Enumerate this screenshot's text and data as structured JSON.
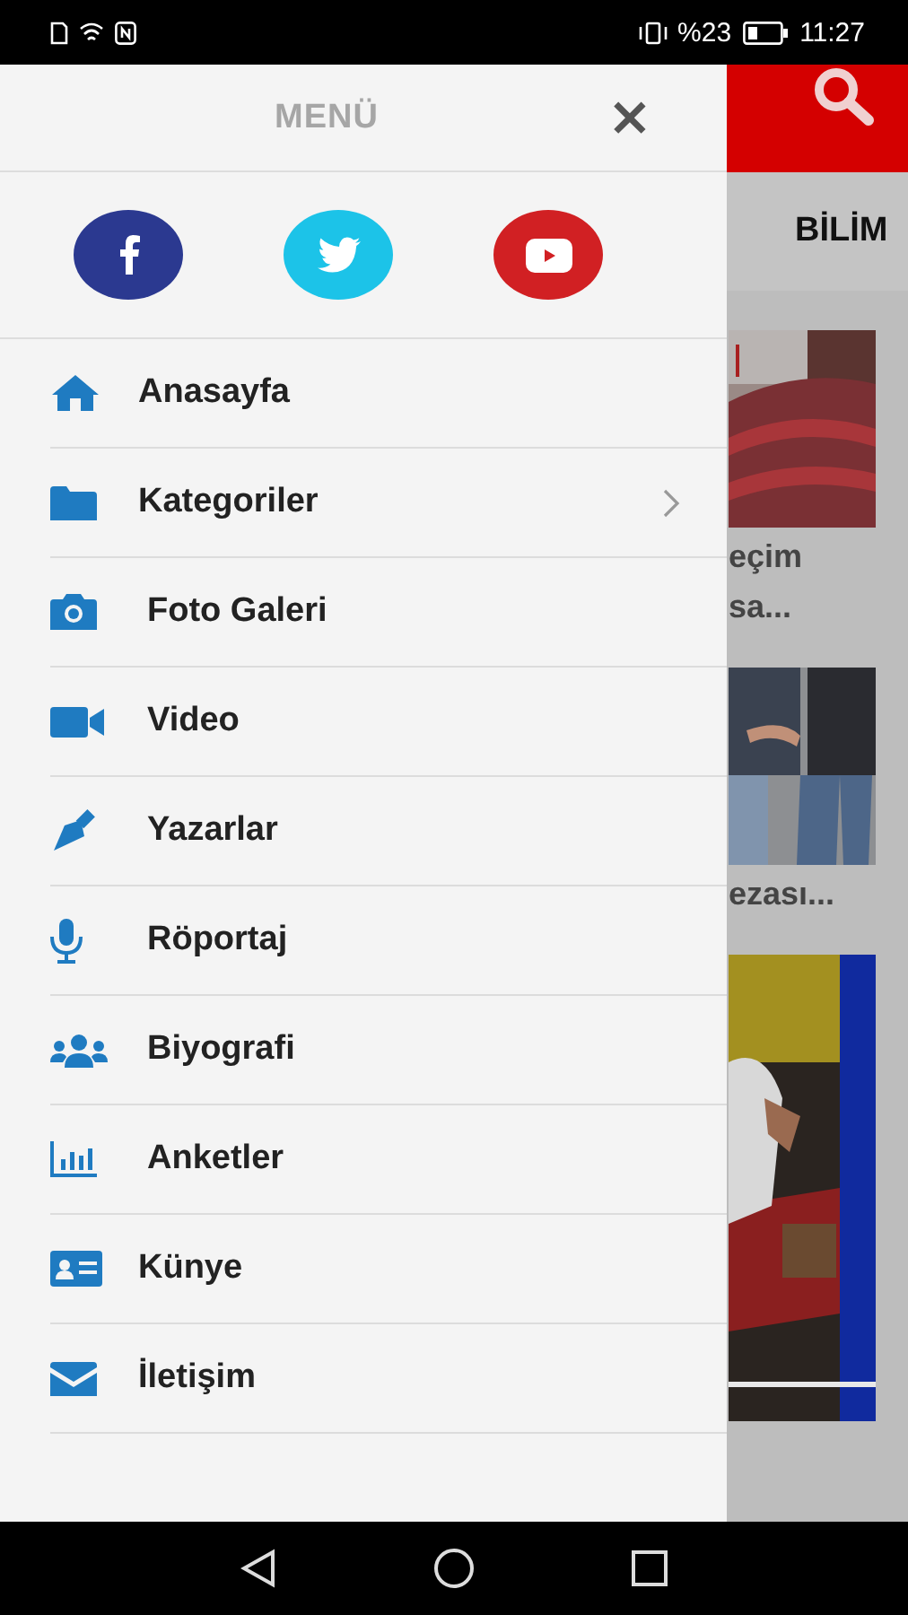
{
  "status_bar": {
    "battery_percent": "%23",
    "time": "11:27"
  },
  "menu": {
    "title": "MENÜ",
    "close": "×",
    "social": [
      {
        "kind": "facebook",
        "color": "#2b3990"
      },
      {
        "kind": "twitter",
        "color": "#1cc3e8"
      },
      {
        "kind": "youtube",
        "color": "#d12023"
      }
    ],
    "items": [
      {
        "label": "Anasayfa",
        "has_submenu": false
      },
      {
        "label": "Kategoriler",
        "has_submenu": true
      },
      {
        "label": "Foto Galeri",
        "has_submenu": false
      },
      {
        "label": "Video",
        "has_submenu": false
      },
      {
        "label": "Yazarlar",
        "has_submenu": false
      },
      {
        "label": "Röportaj",
        "has_submenu": false
      },
      {
        "label": "Biyografi",
        "has_submenu": false
      },
      {
        "label": "Anketler",
        "has_submenu": false
      },
      {
        "label": "Künye",
        "has_submenu": false
      },
      {
        "label": "İletişim",
        "has_submenu": false
      }
    ]
  },
  "background_page": {
    "tab": "BİLİM",
    "articles": [
      {
        "kind": "picture",
        "lines": [
          "eçim",
          "sa..."
        ]
      },
      {
        "kind": "picture",
        "lines": [
          "ezası..."
        ]
      },
      {
        "kind": "picture"
      }
    ]
  }
}
